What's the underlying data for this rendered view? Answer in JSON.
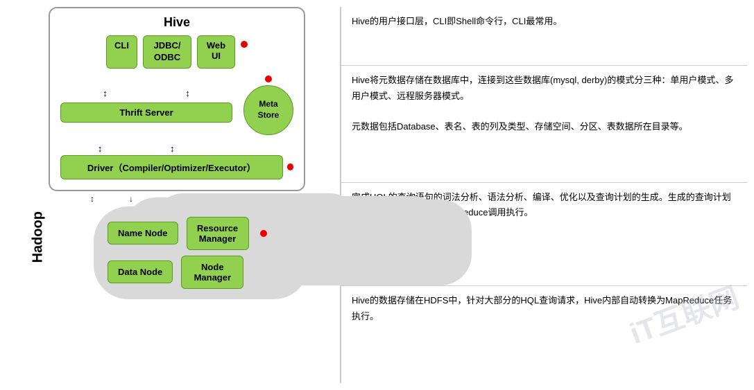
{
  "diagram": {
    "hive_title": "Hive",
    "hadoop_title": "Hadoop",
    "components": {
      "cli": "CLI",
      "jdbc_odbc": "JDBC/\nODBC",
      "web_ui": "Web\nUI",
      "thrift_server": "Thrift Server",
      "meta_store": "Meta\nStore",
      "driver": "Driver（Compiler/Optimizer/Executor）",
      "name_node": "Name Node",
      "resource_manager": "Resource\nManager",
      "data_node": "Data Node",
      "node_manager": "Node\nManager"
    }
  },
  "annotations": {
    "block1": "Hive的用户接口层，CLI即Shell命令行，CLI最常用。",
    "block2": "Hive将元数据存储在数据库中，连接到这些数据库(mysql, derby)的模式分三种：单用户模式、多用户模式、远程服务器模式。\n\n元数据包括Database、表名、表的列及类型、存储空间、分区、表数据所在目录等。",
    "block3": "完成HQL的查询语句的词法分析、语法分析、编译、优化以及查询计划的生成。生成的查询计划存储在HDFS中，并由MapReduce调用执行。",
    "block4": "Hive的数据存储在HDFS中，针对大部分的HQL查询请求，Hive内部自动转换为MapReduce任务执行。"
  },
  "watermark": "iT互联网"
}
